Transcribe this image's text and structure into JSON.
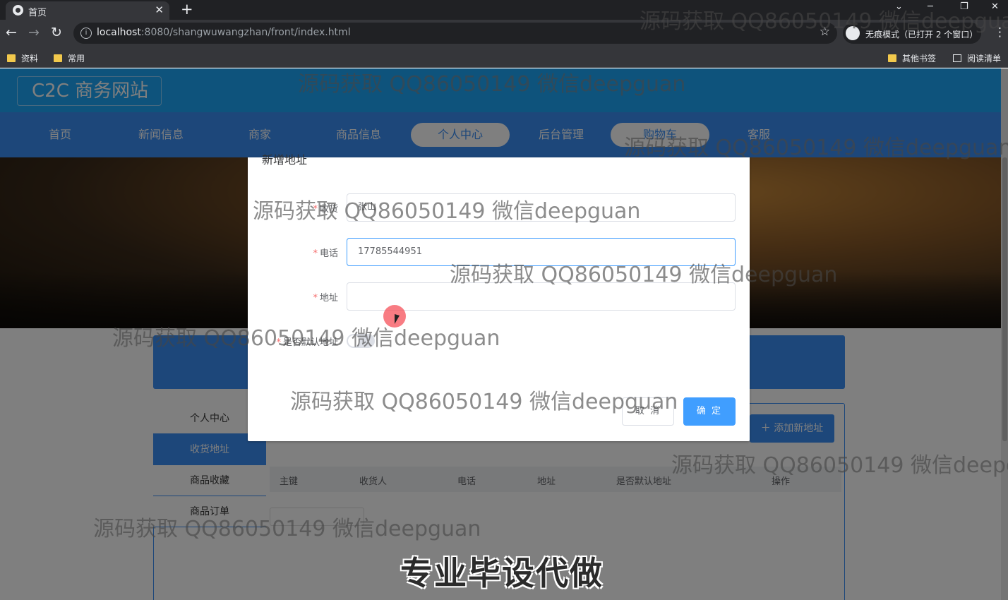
{
  "browser": {
    "tab_title": "首页",
    "tab_close": "✕",
    "new_tab": "+",
    "window_controls": [
      "⌄",
      "─",
      "❐",
      "✕"
    ],
    "url_host": "localhost",
    "url_rest": ":8080/shangwuwangzhan/front/index.html",
    "incognito_label": "无痕模式（已打开 2 个窗口）",
    "bookmarks": [
      "资料",
      "常用",
      "其他书签",
      "阅读清单"
    ]
  },
  "site": {
    "logo": "C2C 商务网站",
    "nav": [
      "首页",
      "新闻信息",
      "商家",
      "商品信息",
      "个人中心",
      "后台管理",
      "购物车",
      "客服"
    ],
    "active_nav": "个人中心"
  },
  "sidebar": [
    "个人中心",
    "收货地址",
    "商品收藏",
    "商品订单"
  ],
  "add_button": "添加新地址",
  "table_headers": [
    "主键",
    "收货人",
    "电话",
    "地址",
    "是否默认地址",
    "操作"
  ],
  "dialog": {
    "title": "新增地址",
    "fields": [
      {
        "label": "收货",
        "value": "张山"
      },
      {
        "label": "电话",
        "value": "17785544951"
      },
      {
        "label": "地址",
        "value": ""
      },
      {
        "label": "是否默认地址",
        "value": ""
      }
    ],
    "default_switch_on": false,
    "cancel": "取 消",
    "confirm": "确 定"
  },
  "watermark_text": "源码获取 QQ86050149 微信deepguan",
  "caption": "专业毕设代做",
  "colors": {
    "header": "#1ca7f8",
    "nav": "#3a8ef5",
    "primary": "#409eff"
  }
}
